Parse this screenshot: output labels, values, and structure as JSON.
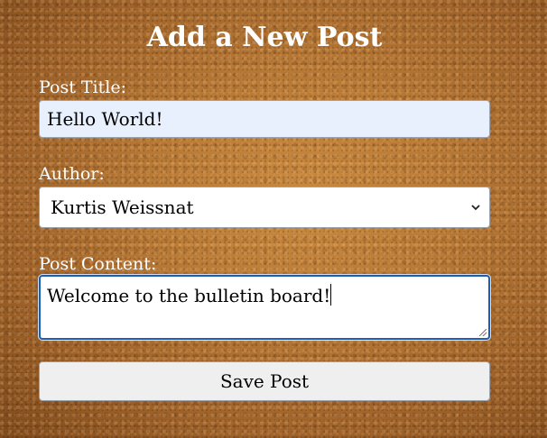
{
  "form": {
    "heading": "Add a New Post",
    "title_label": "Post Title:",
    "title_value": "Hello World!",
    "author_label": "Author:",
    "author_selected": "Kurtis Weissnat",
    "content_label": "Post Content:",
    "content_value": "Welcome to the bulletin board!",
    "save_label": "Save Post"
  },
  "icons": {
    "select_arrow": "chevron-down-icon"
  },
  "colors": {
    "background": "#a8692c",
    "input_autofill": "#e8f0fe",
    "focus_border": "#1a5fb4",
    "button_bg": "#efefef"
  }
}
